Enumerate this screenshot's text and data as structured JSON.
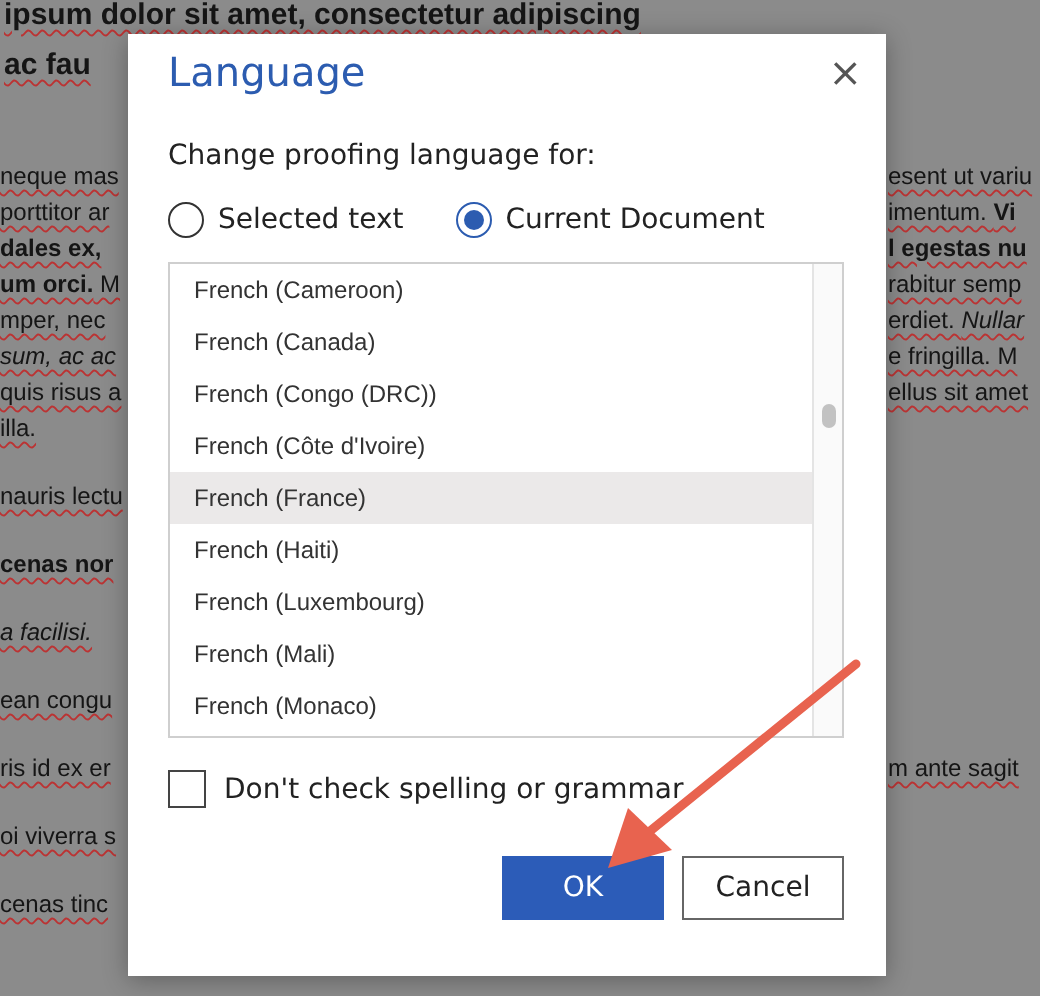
{
  "document": {
    "heading_lines": [
      "ipsum dolor sit amet, consectetur adipiscing",
      "ac fau"
    ],
    "paragraphs": [
      {
        "lines": [
          {
            "left": "neque mas",
            "right": "esent ut variu"
          },
          {
            "left": "porttitor ar",
            "right": "imentum. **Vi**"
          },
          {
            "left": "dales ex,",
            "left_bold": true,
            "right": "l egestas nu",
            "right_bold": true
          },
          {
            "left": "**um orci.** M",
            "right": "rabitur semp"
          },
          {
            "left": "mper, nec",
            "right": "erdiet. *Nullar*"
          },
          {
            "left": "sum, ac ac",
            "left_italic": true,
            "right": "e fringilla. M"
          },
          {
            "left": "quis risus a",
            "right": "ellus sit amet"
          },
          {
            "left": "illa."
          }
        ]
      },
      {
        "lines": [
          {
            "left": "nauris lectu"
          }
        ]
      },
      {
        "lines": [
          {
            "left": "cenas nor",
            "left_bold": true
          }
        ]
      },
      {
        "lines": [
          {
            "left": "a facilisi.",
            "left_italic": true
          }
        ]
      },
      {
        "lines": [
          {
            "left": "ean congu"
          }
        ]
      },
      {
        "lines": [
          {
            "left": "ris id ex er",
            "right": "m ante sagit"
          }
        ]
      },
      {
        "lines": [
          {
            "left": "oi viverra s"
          }
        ]
      },
      {
        "lines": [
          {
            "left": "cenas tinc"
          }
        ]
      }
    ]
  },
  "dialog": {
    "title": "Language",
    "close": "×",
    "prompt": "Change proofing language for:",
    "scope_options": [
      {
        "label": "Selected text",
        "selected": false
      },
      {
        "label": "Current Document",
        "selected": true
      }
    ],
    "languages": [
      {
        "label": "French (Cameroon)",
        "selected": false
      },
      {
        "label": "French (Canada)",
        "selected": false
      },
      {
        "label": "French (Congo (DRC))",
        "selected": false
      },
      {
        "label": "French (Côte d'Ivoire)",
        "selected": false
      },
      {
        "label": "French (France)",
        "selected": true
      },
      {
        "label": "French (Haiti)",
        "selected": false
      },
      {
        "label": "French (Luxembourg)",
        "selected": false
      },
      {
        "label": "French (Mali)",
        "selected": false
      },
      {
        "label": "French (Monaco)",
        "selected": false
      }
    ],
    "no_proofing": {
      "label": "Don't check spelling or grammar",
      "checked": false
    },
    "buttons": [
      {
        "label": "OK",
        "kind": "primary"
      },
      {
        "label": "Cancel",
        "kind": "secondary"
      }
    ]
  }
}
